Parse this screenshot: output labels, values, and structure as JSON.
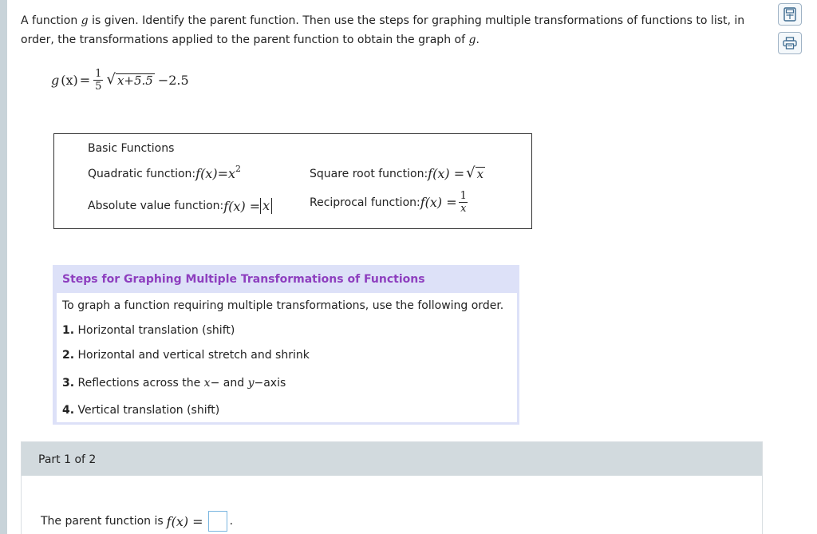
{
  "question": {
    "intro_part1": "A function ",
    "intro_g1": "g",
    "intro_part2": " is given. Identify the parent function. Then use the steps for graphing multiple transformations of functions to list, in order, the transformations applied to the parent function to obtain the graph of ",
    "intro_g2": "g",
    "intro_end": ".",
    "g_label": "g",
    "g_arg": "(x)",
    "equals": "=",
    "frac_num": "1",
    "frac_den": "5",
    "sqrt_arg": "x+5.5",
    "g_tail": "−2.5"
  },
  "basic_functions": {
    "title": "Basic Functions",
    "quadratic_label": "Quadratic function: ",
    "quadratic_expr": "f(x)=x",
    "quadratic_exp": "2",
    "absolute_label": "Absolute value function: ",
    "absolute_expr": "f(x) = ",
    "absolute_arg": "x",
    "sqrt_label": "Square root function: ",
    "sqrt_expr": "f(x) = ",
    "sqrt_arg": "x",
    "recip_label": "Reciprocal function: ",
    "recip_expr": "f(x) = ",
    "recip_num": "1",
    "recip_den": "x"
  },
  "steps": {
    "header": "Steps for Graphing Multiple Transformations of Functions",
    "intro": "To graph a function requiring multiple transformations, use the following order.",
    "items": [
      {
        "num": "1.",
        "text": " Horizontal translation (shift)"
      },
      {
        "num": "2.",
        "text": " Horizontal and vertical stretch and shrink"
      },
      {
        "num": "3.",
        "text_a": " Reflections across the ",
        "var_x": "x",
        "text_b": "− and ",
        "var_y": "y",
        "text_c": "−axis"
      },
      {
        "num": "4.",
        "text": " Vertical translation (shift)"
      }
    ]
  },
  "part": {
    "label": "Part 1 of 2",
    "answer_prefix": "The parent function is ",
    "answer_expr": "f(x) = ",
    "answer_suffix": "."
  },
  "side_tools": {
    "tool1_icon": "calculator-icon",
    "tool2_icon": "print-icon"
  }
}
